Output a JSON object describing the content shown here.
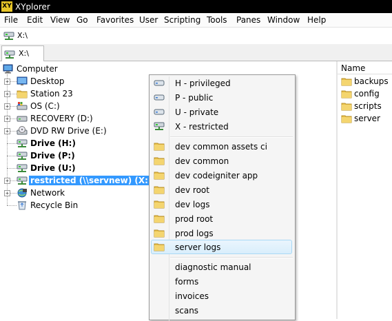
{
  "window": {
    "title": "XYplorer",
    "app_icon_text": "XY"
  },
  "menubar": [
    "File",
    "Edit",
    "View",
    "Go",
    "Favorites",
    "User",
    "Scripting",
    "Tools",
    "Panes",
    "Window",
    "Help"
  ],
  "address": {
    "value": "X:\\"
  },
  "tabs": [
    {
      "label": "X:\\"
    }
  ],
  "tree": {
    "root": "Computer",
    "items": [
      {
        "label": "Desktop",
        "icon": "desktop-icon"
      },
      {
        "label": "Station 23",
        "icon": "folder-icon"
      },
      {
        "label": "OS (C:)",
        "icon": "drive-icon"
      },
      {
        "label": "RECOVERY (D:)",
        "icon": "drive-icon"
      },
      {
        "label": "DVD RW Drive (E:)",
        "icon": "dvd-drive-icon"
      },
      {
        "label": "Drive (H:)",
        "icon": "network-drive-icon"
      },
      {
        "label": "Drive (P:)",
        "icon": "network-drive-icon"
      },
      {
        "label": "Drive (U:)",
        "icon": "network-drive-icon"
      },
      {
        "label": "restricted (\\\\servnew) (X:)",
        "icon": "network-drive-icon"
      },
      {
        "label": "Network",
        "icon": "network-icon"
      },
      {
        "label": "Recycle Bin",
        "icon": "recycle-bin-icon"
      }
    ]
  },
  "list": {
    "column": "Name",
    "items": [
      "backups",
      "config",
      "scripts",
      "server"
    ]
  },
  "context_menu": {
    "drives": [
      "H - privileged",
      "P - public",
      "U - private",
      "X - restricted"
    ],
    "folders": [
      "dev common assets ci",
      "dev common",
      "dev codeigniter app",
      "dev root",
      "dev logs",
      "prod root",
      "prod logs",
      "server logs"
    ],
    "documents": [
      "diagnostic manual",
      "forms",
      "invoices",
      "scans"
    ]
  },
  "colors": {
    "selection": "#3399ff",
    "folder": "#e8c04a",
    "title_bar": "#000000",
    "menu_hover_border": "#a8d8f5"
  }
}
